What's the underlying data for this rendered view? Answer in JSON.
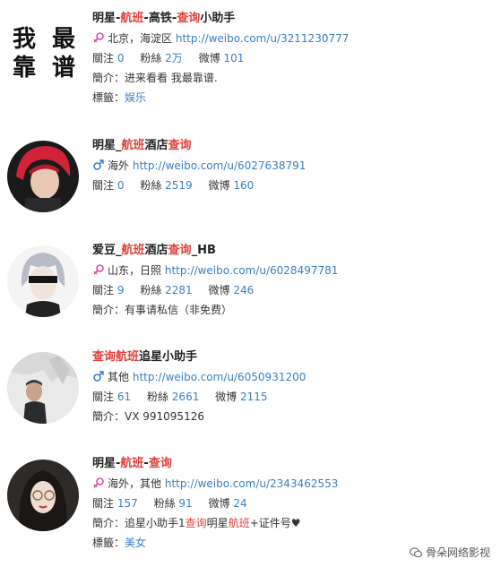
{
  "items": [
    {
      "avatar_text": [
        "我",
        "最",
        "靠",
        "谱"
      ],
      "name": [
        "明星-",
        "航班",
        "-高铁-",
        "查询",
        "小助手"
      ],
      "location": "北京，海淀区",
      "url": "http://weibo.com/u/3211230777",
      "follow_label": "關注",
      "follow": "0",
      "fans_label": "粉絲",
      "fans": "2万",
      "weibo_label": "微博",
      "weibo": "101",
      "intro_label": "簡介：",
      "intro": [
        "进来看看 我最靠谱."
      ],
      "tags_label": "標籤：",
      "tags": "娱乐",
      "gender": "female"
    },
    {
      "name": [
        "明星_",
        "航班",
        "酒店",
        "查询",
        ""
      ],
      "location": "海外",
      "url": "http://weibo.com/u/6027638791",
      "follow_label": "關注",
      "follow": "0",
      "fans_label": "粉絲",
      "fans": "2519",
      "weibo_label": "微博",
      "weibo": "160",
      "gender": "male"
    },
    {
      "name": [
        "爱豆_",
        "航班",
        "酒店",
        "查询",
        "_HB"
      ],
      "location": "山东，日照",
      "url": "http://weibo.com/u/6028497781",
      "follow_label": "關注",
      "follow": "9",
      "fans_label": "粉絲",
      "fans": "2281",
      "weibo_label": "微博",
      "weibo": "246",
      "intro_label": "簡介：",
      "intro": [
        "有事请私信（非免费）"
      ],
      "gender": "female"
    },
    {
      "name": [
        "",
        "查询航班",
        "追星小助手",
        "",
        ""
      ],
      "location": "其他",
      "url": "http://weibo.com/u/6050931200",
      "follow_label": "關注",
      "follow": "61",
      "fans_label": "粉絲",
      "fans": "2661",
      "weibo_label": "微博",
      "weibo": "2115",
      "intro_label": "簡介：",
      "intro": [
        "VX 991095126"
      ],
      "gender": "male"
    },
    {
      "name": [
        "明星-",
        "航班",
        "-",
        "查询",
        ""
      ],
      "location": "海外，其他",
      "url": "http://weibo.com/u/2343462553",
      "follow_label": "關注",
      "follow": "157",
      "fans_label": "粉絲",
      "fans": "91",
      "weibo_label": "微博",
      "weibo": "24",
      "intro_label": "簡介：",
      "intro": [
        "追星小助手1",
        "查询",
        "明星",
        "航班",
        "+证件号♥"
      ],
      "tags_label": "標籤：",
      "tags": "美女",
      "gender": "female"
    }
  ],
  "footer": {
    "text": "骨朵网络影视"
  },
  "colors": {
    "accent": "#e0413b",
    "link": "#3a7fc1",
    "male": "#3a7fc1",
    "female": "#d94aa7"
  }
}
